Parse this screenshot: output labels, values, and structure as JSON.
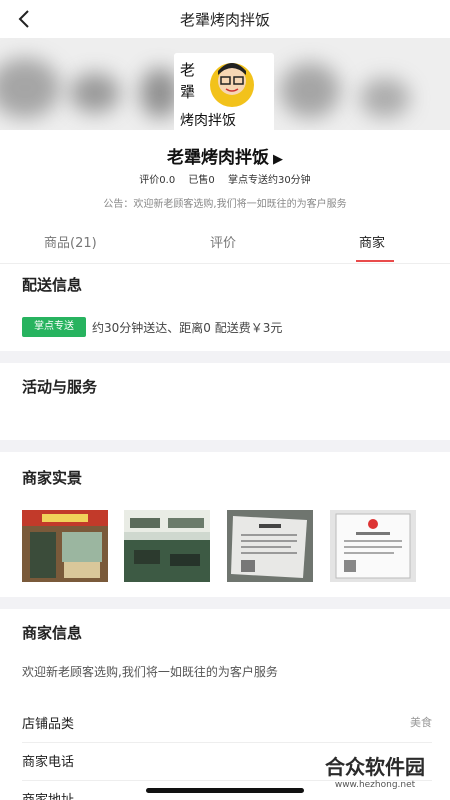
{
  "nav": {
    "title": "老犟烤肉拌饭",
    "back_icon": "chevron-left-icon"
  },
  "logo": {
    "lines": [
      "老",
      "犟",
      "烤肉拌饭"
    ]
  },
  "shop": {
    "name": "老犟烤肉拌饭",
    "arrow": "▶",
    "rating": "评价0.0",
    "sold": "已售0",
    "delivery": "掌点专送约30分钟",
    "notice": "公告：欢迎新老顾客选购,我们将一如既往的为客户服务"
  },
  "tabs": [
    {
      "label": "商品(21)",
      "active": false
    },
    {
      "label": "评价",
      "active": false
    },
    {
      "label": "商家",
      "active": true
    }
  ],
  "delivery_info": {
    "title": "配送信息",
    "badge": "掌点专送",
    "text": "约30分钟送达、距离0 配送费￥3元"
  },
  "activities": {
    "title": "活动与服务"
  },
  "photos": {
    "title": "商家实景",
    "count": 4
  },
  "merchant_info": {
    "title": "商家信息",
    "desc": "欢迎新老顾客选购,我们将一如既往的为客户服务",
    "rows": [
      {
        "key": "店铺品类",
        "value": "美食"
      },
      {
        "key": "商家电话",
        "value": ""
      },
      {
        "key": "商家地址",
        "value": ""
      }
    ]
  },
  "watermark": {
    "name": "合众软件园",
    "url": "www.hezhong.net"
  },
  "colors": {
    "accent": "#e94b4b",
    "badge_green": "#27b35f",
    "divider": "#f2f2f5"
  }
}
